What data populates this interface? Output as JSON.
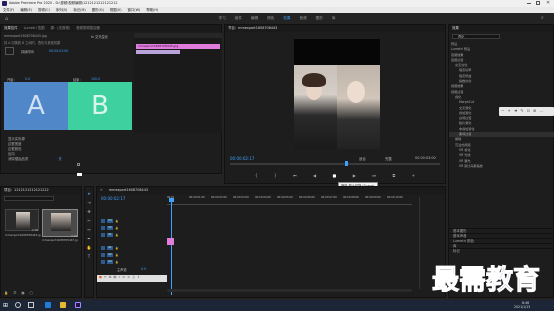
{
  "titlebar": {
    "title": "Adobe Premiere Pro 2020 - D:\\视频\\视频编辑\\1212121212121212"
  },
  "menubar": {
    "items": [
      "文件(F)",
      "编辑(E)",
      "剪辑(C)",
      "序列(S)",
      "标记(M)",
      "图形(G)",
      "视图(V)",
      "窗口(W)",
      "帮助(H)"
    ]
  },
  "workspaces": {
    "items": [
      "学习",
      "组件",
      "编辑",
      "颜色",
      "效果",
      "音频",
      "图形",
      "库"
    ],
    "active": "效果"
  },
  "effect_controls": {
    "tabs": [
      "效果控件",
      "Lumetri 范围",
      "源：(无剪辑)",
      "音频剪辑混合器"
    ],
    "clip_label": "mmexport1608708443.jpg",
    "fx_label": "fx 交叉溢化",
    "desc": "将 A 切换到 B 之间时，叠化与其他效果",
    "duration_label": "持续时间",
    "duration": "00:00:01:00",
    "start_label": "开始：",
    "start_val": "0.0",
    "end_label": "结束：",
    "end_val": "100.0",
    "A": "A",
    "B": "B",
    "rows": [
      "显示实际源",
      "边框宽度",
      "边框颜色",
      "反向",
      "消除锯齿品质"
    ],
    "quality": "关"
  },
  "mini_timeline": {
    "clip": "mmexport1608708443.jpg"
  },
  "program": {
    "tab": "节目：mmexport1608708443",
    "timecode": "00:00:02:17",
    "fit": "适合",
    "full": "完整",
    "end_tc": "00:00:03:00"
  },
  "tooltip": "播放-停止切换 (Space)",
  "project": {
    "title": "项目：1212121212121212",
    "search_placeholder": "",
    "items": [
      "mmexport1608708443.jpg",
      "mmexport1608705447.jpg"
    ],
    "durations": [
      "2:00",
      "3:00"
    ]
  },
  "timeline": {
    "tab": "mmexport1608708443",
    "timecode": "00:00:02:17",
    "ruler": [
      "00:00",
      "00:00:01:00",
      "00:00:02:00",
      "00:00:03:00",
      "00:00:04:00",
      "00:00:05:00",
      "00:00:06:00",
      "00:00:07:00",
      "00:00:08:00",
      "00:00:09:00",
      "00:00:10:00"
    ],
    "tracks": [
      "V3",
      "V2",
      "V1",
      "A1",
      "A2",
      "A3"
    ],
    "master": "主声道",
    "master_val": "0.0"
  },
  "effects": {
    "title": "效果",
    "search": "叠化",
    "tree": [
      {
        "label": "预设",
        "hl": false
      },
      {
        "label": "Lumetri 预设",
        "hl": false
      },
      {
        "label": "音频效果",
        "hl": false
      },
      {
        "label": "音频过渡",
        "hl": false
      },
      {
        "label": "交叉淡化",
        "hl": false
      },
      {
        "label": "恒定功率",
        "hl": false
      },
      {
        "label": "恒定增益",
        "hl": false
      },
      {
        "label": "指数淡化",
        "hl": false
      },
      {
        "label": "视频效果",
        "hl": false
      },
      {
        "label": "视频过渡",
        "hl": false
      },
      {
        "label": "叠化",
        "hl": false
      },
      {
        "label": "MorphCut",
        "hl": false
      },
      {
        "label": "交叉溶化",
        "hl": false
      },
      {
        "label": "叠加溶化",
        "hl": false
      },
      {
        "label": "白场过渡",
        "hl": false
      },
      {
        "label": "胶片溶化",
        "hl": false
      },
      {
        "label": "非叠加溶化",
        "hl": false
      },
      {
        "label": "黑场过渡",
        "hl": true
      },
      {
        "label": "擦除",
        "hl": false
      },
      {
        "label": "沉浸式视频",
        "hl": false
      },
      {
        "label": "VR 叠化",
        "hl": false
      },
      {
        "label": "VR 光线",
        "hl": false
      },
      {
        "label": "VR 漏光",
        "hl": false
      },
      {
        "label": "VR 默比乌斯缩放",
        "hl": false
      }
    ],
    "bottom": [
      "基本图形",
      "基本声音",
      "Lumetri 颜色",
      "库",
      "标记"
    ]
  },
  "watermark": "最需教育",
  "taskbar": {
    "time": "8:46",
    "date": "2021/1/15"
  },
  "colors": {
    "accent": "#3ea0ff",
    "clip_pink": "#e07cdc",
    "A_block": "#4f87c8",
    "B_block": "#3fd0a0",
    "watermark": "#2c3a8c"
  }
}
